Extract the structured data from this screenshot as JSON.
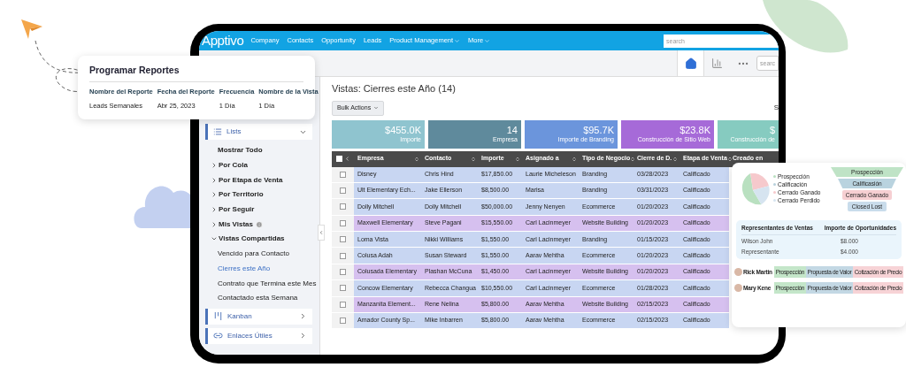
{
  "top_nav": {
    "logo": "Apptivo",
    "items": [
      {
        "label": "Company",
        "dropdown": false
      },
      {
        "label": "Contacts",
        "dropdown": false
      },
      {
        "label": "Opportunity",
        "dropdown": false
      },
      {
        "label": "Leads",
        "dropdown": false
      },
      {
        "label": "Product Management",
        "dropdown": true
      },
      {
        "label": "More",
        "dropdown": true
      }
    ],
    "search": {
      "placeholder": "search"
    }
  },
  "toolbar": {
    "search": {
      "placeholder": "searc"
    }
  },
  "sidebar": {
    "lists": {
      "label": "Lists",
      "expanded": true
    },
    "items": [
      {
        "kind": "link",
        "label": "Mostrar Todo"
      },
      {
        "kind": "group",
        "label": "Por Cola",
        "expanded": false
      },
      {
        "kind": "group",
        "label": "Por Etapa de Venta",
        "expanded": false
      },
      {
        "kind": "group",
        "label": "Por Territorio",
        "expanded": false
      },
      {
        "kind": "group",
        "label": "Por Seguir",
        "expanded": false
      },
      {
        "kind": "group",
        "label": "Mis Vistas",
        "expanded": false,
        "info": true
      },
      {
        "kind": "group",
        "label": "Vistas Compartidas",
        "expanded": true,
        "children": [
          {
            "label": "Vencido para Contacto",
            "selected": false
          },
          {
            "label": "Cierres este Año",
            "selected": true
          },
          {
            "label": "Contrato que Termina este Mes",
            "selected": false
          },
          {
            "label": "Contactado esta Semana",
            "selected": false
          }
        ]
      }
    ],
    "sections": [
      {
        "kind": "kanban",
        "label": "Kanban"
      },
      {
        "kind": "link",
        "label": "Enlaces Útiles"
      }
    ]
  },
  "main": {
    "title": "Vistas: Cierres este Año (14)",
    "bulk_actions": "Bulk Actions",
    "cut_label": "S",
    "tiles": [
      {
        "value": "$455.0K",
        "label": "Importe",
        "color": "#8fc4cf"
      },
      {
        "value": "14",
        "label": "Empresa",
        "color": "#5f8a9c"
      },
      {
        "value": "$95.7K",
        "label": "Importe de Branding",
        "color": "#6b95dc"
      },
      {
        "value": "$23.8K",
        "label": "Construcción de Sitio Web",
        "color": "#a66ad8"
      },
      {
        "value": "$",
        "label": "Construcción de",
        "color": "#86cbc0"
      }
    ],
    "table": {
      "select_all": {
        "checked": false
      },
      "columns": [
        "Empresa",
        "Contacto",
        "Importe",
        "Asignado a",
        "Tipo de Negocio",
        "Cierre de D.",
        "Etapa de Venta",
        "Creado en"
      ],
      "rows": [
        {
          "checked": false,
          "color": "#c8d6f2",
          "cells": [
            "Disney",
            "Chris Hind",
            "$17,850.00",
            "Laurie Micheleson",
            "Branding",
            "03/28/2023",
            "Calificado"
          ]
        },
        {
          "checked": false,
          "color": "#c8d6f2",
          "cells": [
            "Ult Elementary Ech...",
            "Jake Ellerson",
            "$8,500.00",
            "Marisa",
            "Branding",
            "03/31/2023",
            "Calificado"
          ]
        },
        {
          "checked": false,
          "color": "#c8d6f2",
          "cells": [
            "Dolly Mitchell",
            "Dolly Mitchell",
            "$50,000.00",
            "Jenny Nenyen",
            "Ecommerce",
            "01/20/2023",
            "Calificado"
          ]
        },
        {
          "checked": false,
          "color": "#d6c0ef",
          "cells": [
            "Maxwell Elementary",
            "Steve Pagani",
            "$15,550.00",
            "Carl Lacinmeyer",
            "Website Building",
            "01/20/2023",
            "Calificado"
          ]
        },
        {
          "checked": false,
          "color": "#c8d6f2",
          "cells": [
            "Loma Vista",
            "Nikki Williams",
            "$1,550.00",
            "Carl Lacinmeyer",
            "Branding",
            "01/15/2023",
            "Calificado"
          ]
        },
        {
          "checked": false,
          "color": "#c8d6f2",
          "cells": [
            "Colusa Adah",
            "Susan Steward",
            "$1,550.00",
            "Aarav Mehtha",
            "Ecommerce",
            "01/20/2023",
            "Calificado"
          ]
        },
        {
          "checked": false,
          "color": "#d6c0ef",
          "cells": [
            "Colusada Elementary",
            "Plashan McCuna",
            "$1,450.00",
            "Carl Lacinmeyer",
            "Website Building",
            "01/20/2023",
            "Calificado"
          ]
        },
        {
          "checked": false,
          "color": "#c8d6f2",
          "cells": [
            "Concow Elementary",
            "Rebecca Changua",
            "$10,550.00",
            "Carl Lacinmeyer",
            "Ecommerce",
            "01/28/2023",
            "Calificado"
          ]
        },
        {
          "checked": false,
          "color": "#d6c0ef",
          "cells": [
            "Manzanita Element...",
            "Rene Nelina",
            "$5,800.00",
            "Aarav Mehtha",
            "Website Building",
            "02/15/2023",
            "Calificado"
          ]
        },
        {
          "checked": false,
          "color": "#c8d6f2",
          "cells": [
            "Amador County Sp...",
            "Mike Inbarren",
            "$5,800.00",
            "Aarav Mehtha",
            "Ecommerce",
            "02/15/2023",
            "Calificado"
          ]
        }
      ]
    }
  },
  "report_card": {
    "title": "Programar Reportes",
    "columns": [
      "Nombre del Reporte",
      "Fecha del Reporte",
      "Frecuencia",
      "Nombre de la Vista"
    ],
    "rows": [
      [
        "Leads Semanales",
        "Abr 25, 2023",
        "1 Día",
        "1 Día"
      ]
    ]
  },
  "pipeline_card": {
    "legend": [
      {
        "label": "Prospección",
        "color": "#b9e0c0"
      },
      {
        "label": "Calificación",
        "color": "#b8d0dc"
      },
      {
        "label": "Cerrado Ganado",
        "color": "#f6c9cc"
      },
      {
        "label": "Cerrado Perdido",
        "color": "#d6e4f0"
      }
    ],
    "funnel": [
      {
        "label": "Prospección",
        "color": "#bfe3c6"
      },
      {
        "label": "Calificasión",
        "color": "#b9d3df"
      },
      {
        "label": "Cerrado Ganado",
        "color": "#f6cfd2"
      },
      {
        "label": "Closed Lost",
        "color": "#c9dceb"
      }
    ],
    "reps": {
      "columns": [
        "Representantes de Ventas",
        "Importe de Oportunidades"
      ],
      "rows": [
        [
          "Wilson John",
          "$8.000"
        ],
        [
          "Representante",
          "$4.000"
        ]
      ]
    },
    "people": [
      {
        "name": "Rick Martin",
        "stages": [
          {
            "label": "Prospección",
            "color": "#c4e6c9"
          },
          {
            "label": "Propuesta de Valor",
            "color": "#c3d8e4"
          },
          {
            "label": "Cotización de Precio",
            "color": "#f7d3d6"
          }
        ]
      },
      {
        "name": "Mary Kene",
        "stages": [
          {
            "label": "Prospección",
            "color": "#c4e6c9"
          },
          {
            "label": "Propuesta de Valor",
            "color": "#c3d8e4"
          },
          {
            "label": "Cotización de Precio",
            "color": "#f7d3d6"
          }
        ]
      }
    ]
  }
}
